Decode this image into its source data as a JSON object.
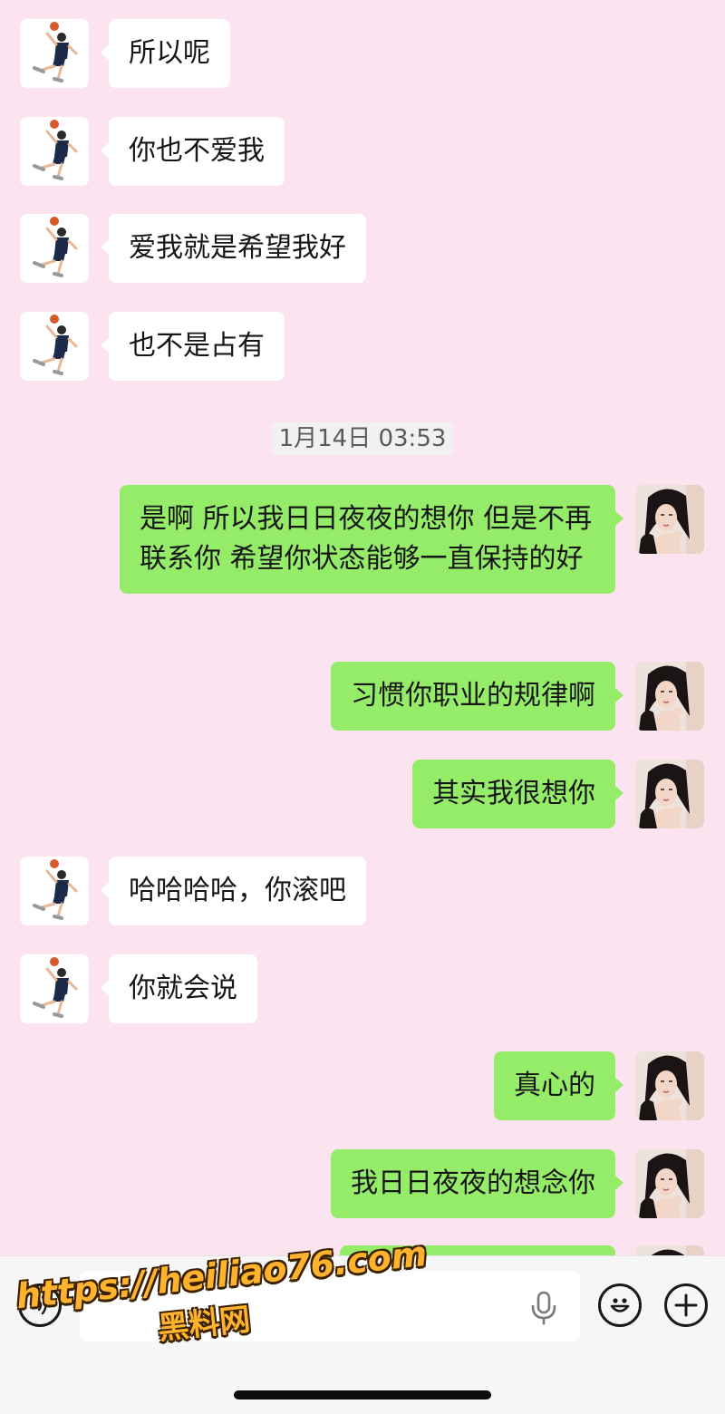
{
  "colors": {
    "background": "#fbe4ef",
    "received_bubble": "#ffffff",
    "sent_bubble": "#95ec69",
    "watermark": "#ffb22e"
  },
  "contacts": {
    "other_avatar": "basketball-player-avatar",
    "self_avatar": "woman-portrait-avatar"
  },
  "messages": {
    "m1": "所以呢",
    "m2": "你也不爱我",
    "m3": "爱我就是希望我好",
    "m4": "也不是占有",
    "m5": "是啊 所以我日日夜夜的想你 但是不再联系你 希望你状态能够一直保持的好",
    "m6": "习惯你职业的规律啊",
    "m7": "其实我很想你",
    "m8": "哈哈哈哈，你滚吧",
    "m9": "你就会说",
    "m10": "真心的",
    "m11": "我日日夜夜的想念你",
    "m12": ""
  },
  "timestamp": "1月14日 03:53",
  "input_bar": {
    "voice_icon": "voice-mode-icon",
    "mic_icon": "microphone-icon",
    "emoji_icon": "emoji-icon",
    "plus_icon": "plus-icon",
    "value": ""
  },
  "watermark": {
    "url": "https://heiliao76.com",
    "name": "黑料网"
  }
}
